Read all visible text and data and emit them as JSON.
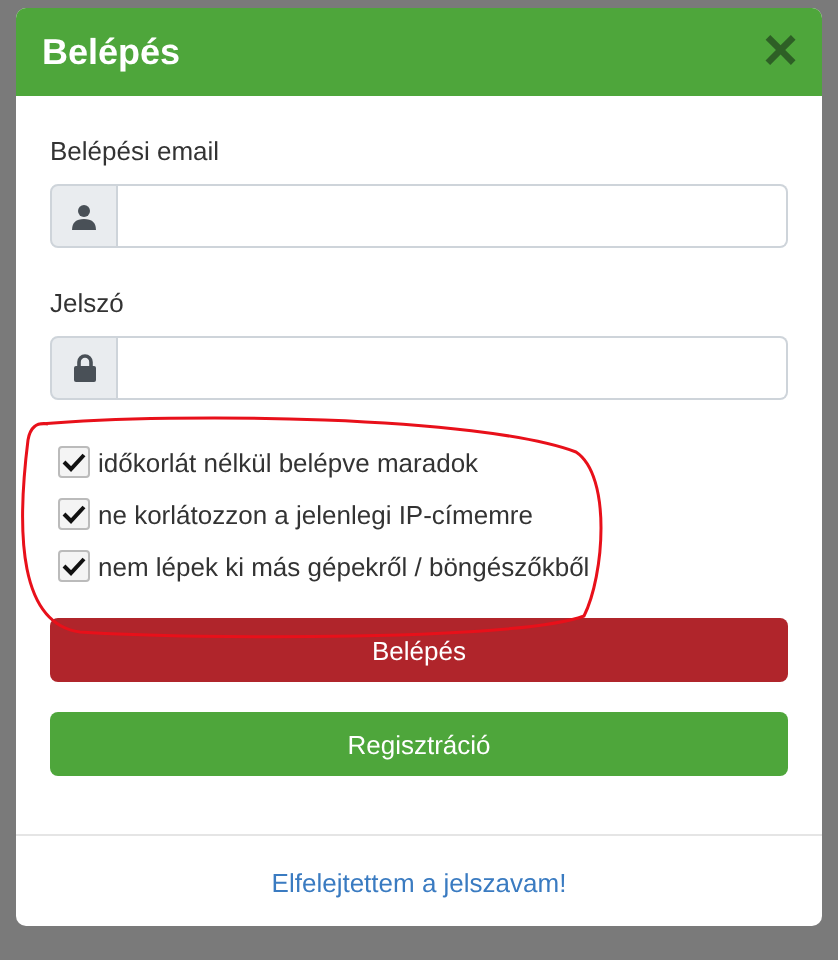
{
  "dialog": {
    "title": "Belépés",
    "close": "×"
  },
  "fields": [
    {
      "label": "Belépési email",
      "kind": "user"
    },
    {
      "label": "Jelszó",
      "kind": "lock"
    }
  ],
  "options": [
    {
      "label": "időkorlát nélkül belépve maradok",
      "checked": true
    },
    {
      "label": "ne korlátozzon a jelenlegi IP-címemre",
      "checked": true
    },
    {
      "label": "nem lépek ki más gépekről / böngészőkből",
      "checked": true
    }
  ],
  "buttons": [
    {
      "label": "Belépés",
      "kind": "danger"
    },
    {
      "label": "Regisztráció",
      "kind": "success"
    }
  ],
  "footer_link": "Elfelejtettem a jelszavam!"
}
